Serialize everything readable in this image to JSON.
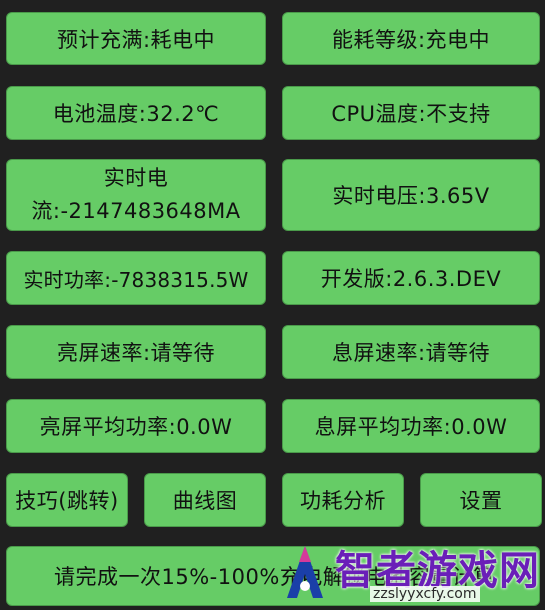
{
  "tiles": {
    "estimated_full": "预计充满:耗电中",
    "energy_level": "能耗等级:充电中",
    "battery_temp": "电池温度:32.2℃",
    "cpu_temp": "CPU温度:不支持",
    "realtime_current_line1": "实时电",
    "realtime_current_line2": "流:-2147483648MA",
    "realtime_voltage": "实时电压:3.65V",
    "realtime_power": "实时功率:-7838315.5W",
    "dev_version": "开发版:2.6.3.DEV",
    "screen_on_rate": "亮屏速率:请等待",
    "screen_off_rate": "息屏速率:请等待",
    "screen_on_avg_power": "亮屏平均功率:0.0W",
    "screen_off_avg_power": "息屏平均功率:0.0W",
    "tips_button": "技巧(跳转)",
    "curve_button": "曲线图",
    "power_analysis_button": "功耗分析",
    "settings_button": "设置",
    "calibration_hint": "请完成一次15%-100%充电解锁电池容量计算"
  },
  "watermark": {
    "title": "智者游戏网",
    "url": "zzslyyxcfy.com"
  },
  "colors": {
    "background": "#202020",
    "tile": "#66CC66",
    "text": "#111111",
    "watermark": "#6a1fb8"
  }
}
